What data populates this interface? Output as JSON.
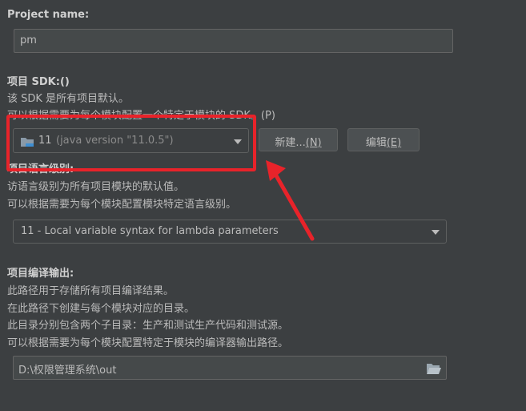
{
  "project_name": {
    "label": "Project name:",
    "value": "pm"
  },
  "sdk": {
    "title": "项目 SDK:()",
    "desc1": "该 SDK 是所有项目默认。",
    "desc2": "可以根据需要为每个模块配置一个特定于模块的 SDK。(P)",
    "selected_version": "11",
    "selected_detail": "(java version \"11.0.5\")",
    "new_label": "新建...",
    "new_mnemonic": "(N)",
    "edit_label": "编辑",
    "edit_mnemonic": "(E)"
  },
  "language_level": {
    "title": "项目语言级别:",
    "desc1": "访语言级别为所有项目模块的默认值。",
    "desc2": "可以根据需要为每个模块配置模块特定语言级别。",
    "selected": "11 - Local variable syntax for lambda parameters"
  },
  "compiler_output": {
    "title": "项目编译输出:",
    "desc1": "此路径用于存储所有项目编译结果。",
    "desc2": "在此路径下创建与每个模块对应的目录。",
    "desc3": "此目录分别包含两个子目录：生产和测试生产代码和测试源。",
    "desc4": "可以根据需要为每个模块配置特定于模块的编译器输出路径。",
    "path": "D:\\权限管理系统\\out"
  },
  "colors": {
    "annotation": "#e8232a",
    "background": "#3c3f41"
  }
}
